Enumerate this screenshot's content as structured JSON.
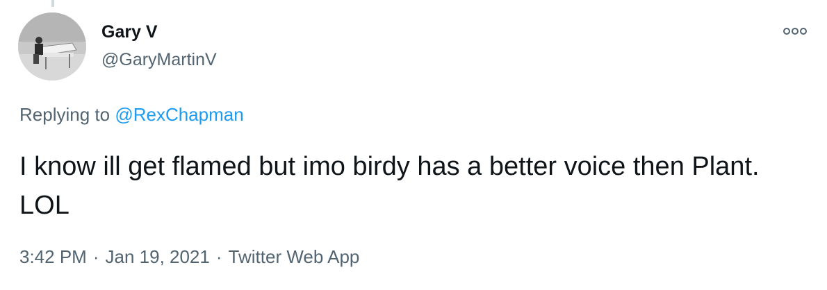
{
  "author": {
    "display_name": "Gary V",
    "handle": "@GaryMartinV"
  },
  "reply": {
    "prefix": "Replying to",
    "mention": "@RexChapman"
  },
  "tweet": {
    "text": "I know ill get flamed but imo birdy has a better voice then Plant.  LOL"
  },
  "meta": {
    "time": "3:42 PM",
    "separator": "·",
    "date": "Jan 19, 2021",
    "source": "Twitter Web App"
  },
  "icons": {
    "more": "more-options-icon",
    "avatar": "avatar-image-piano"
  },
  "colors": {
    "text": "#0f1419",
    "secondary": "#536471",
    "link": "#1d9bf0"
  }
}
